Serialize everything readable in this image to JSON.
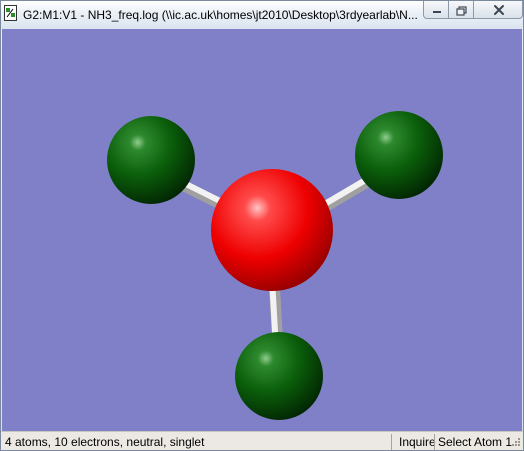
{
  "window": {
    "title": "G2:M1:V1 - NH3_freq.log (\\\\ic.ac.uk\\homes\\jt2010\\Desktop\\3rdyearlab\\N...",
    "icons": [
      "app-icon",
      "minimize-icon",
      "maximize-icon",
      "close-icon"
    ]
  },
  "viewer": {
    "background_color": "#8080c8",
    "atoms": [
      {
        "name": "nitrogen-atom",
        "color": "#ff0000"
      },
      {
        "name": "hydrogen-atom-top-left",
        "color": "#0b6e0b"
      },
      {
        "name": "hydrogen-atom-top-right",
        "color": "#0b6e0b"
      },
      {
        "name": "hydrogen-atom-bottom",
        "color": "#0b6e0b"
      }
    ],
    "bond_color": "#e0e0e0"
  },
  "status": {
    "summary": "4 atoms, 10 electrons, neutral, singlet",
    "mode": "Inquire",
    "selection": "Select Atom 1"
  }
}
